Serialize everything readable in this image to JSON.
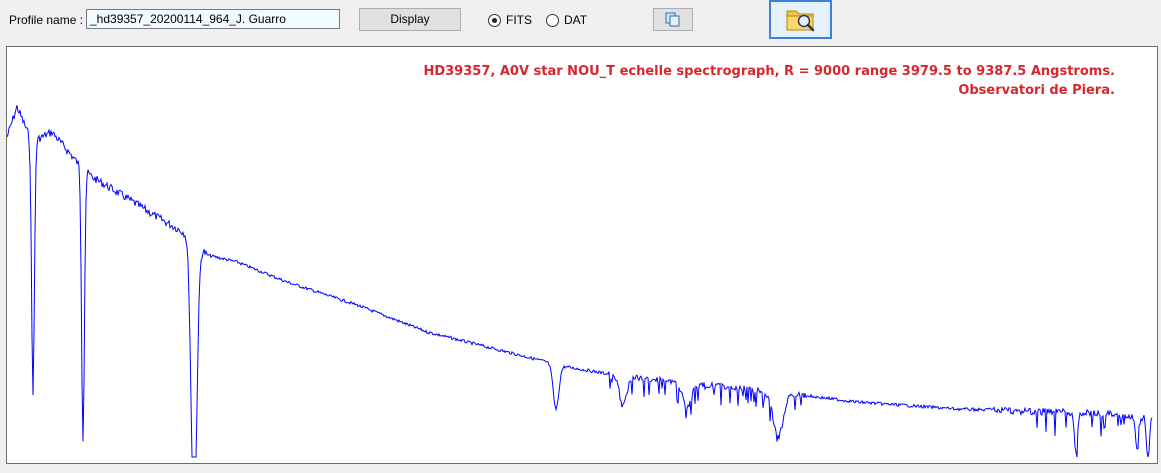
{
  "toolbar": {
    "profile_label": "Profile name :",
    "profile_value": "_hd39357_20200114_964_J. Guarro",
    "display_label": "Display",
    "fits_label": "FITS",
    "dat_label": "DAT",
    "fits_selected": true,
    "copy_icon": "copy-icon",
    "open_icon": "folder-search-icon"
  },
  "plot": {
    "annotation_line1": "HD39357,  A0V star NOU_T echelle spectrograph, R = 9000  range 3979.5 to 9387.5 Angstroms.",
    "annotation_line2": "Observatori de Piera.",
    "annotation_color": "#d8262d",
    "line_color": "#0000ff"
  },
  "chart_data": {
    "type": "line",
    "title": "",
    "xlabel": "",
    "ylabel": "",
    "xlim": [
      3979.5,
      9387.5
    ],
    "series_color": "#0000ff",
    "grid": false
  }
}
